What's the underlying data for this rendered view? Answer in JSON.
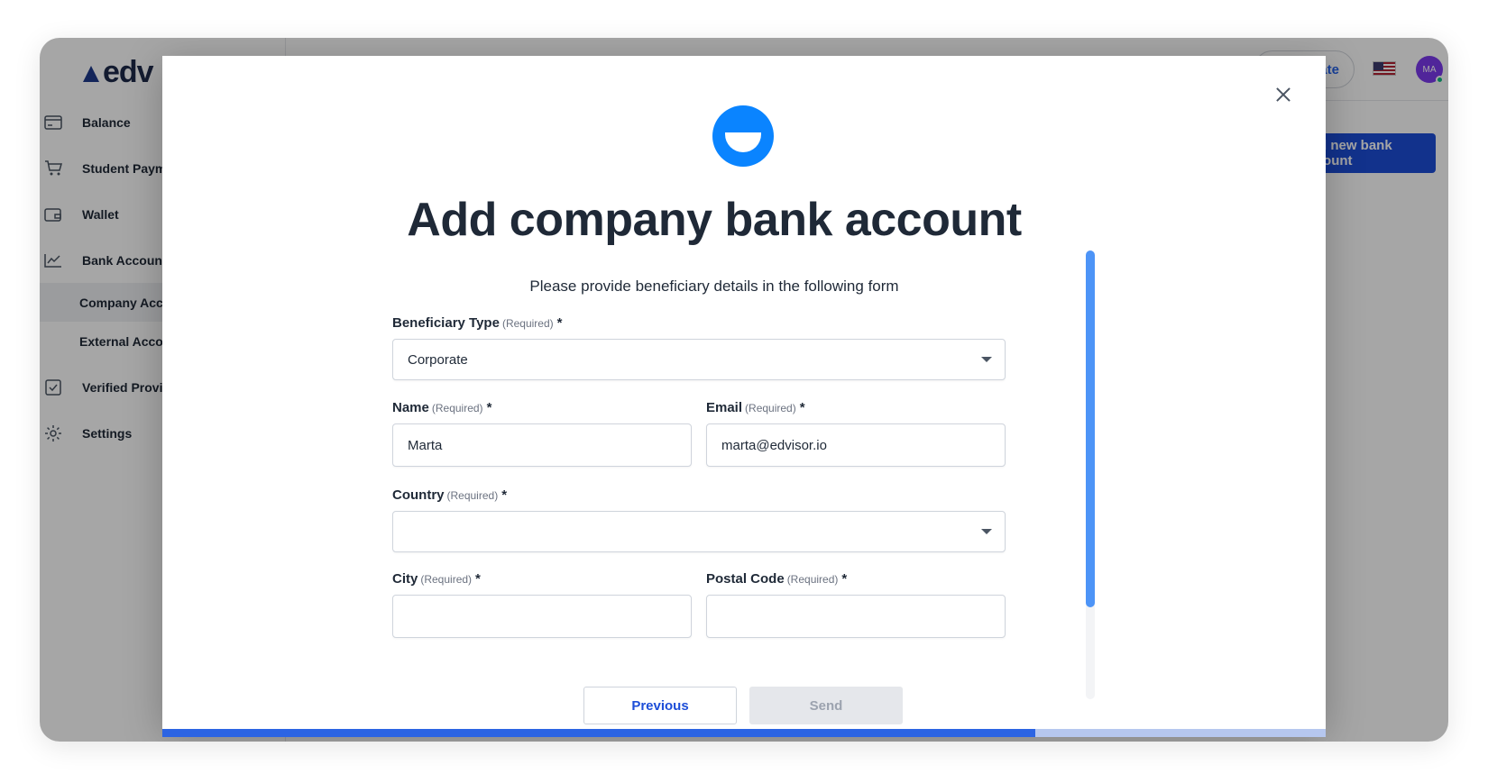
{
  "app": {
    "logo_text": "edv",
    "sidebar": {
      "items": [
        {
          "label": "Balance",
          "icon": "card-icon"
        },
        {
          "label": "Student Payments",
          "icon": "cart-icon"
        },
        {
          "label": "Wallet",
          "icon": "wallet-icon"
        },
        {
          "label": "Bank Accounts",
          "icon": "chart-icon"
        }
      ],
      "sub_items": [
        {
          "label": "Company Accounts",
          "active": true
        },
        {
          "label": "External Accounts",
          "active": false
        }
      ],
      "bottom_items": [
        {
          "label": "Verified Providers",
          "icon": "checkbox-icon"
        },
        {
          "label": "Settings",
          "icon": "gear-icon"
        }
      ]
    },
    "topbar": {
      "pill_label": "Create",
      "avatar_initials": "MA"
    },
    "main": {
      "add_button_label": "Add new bank account"
    }
  },
  "modal": {
    "title": "Add company bank account",
    "subtitle": "Please provide beneficiary details in the following form",
    "fields": {
      "beneficiary_type": {
        "label": "Beneficiary Type",
        "required_text": "(Required)",
        "value": "Corporate"
      },
      "name": {
        "label": "Name",
        "required_text": "(Required)",
        "value": "Marta"
      },
      "email": {
        "label": "Email",
        "required_text": "(Required)",
        "value": "marta@edvisor.io"
      },
      "country": {
        "label": "Country",
        "required_text": "(Required)",
        "value": ""
      },
      "city": {
        "label": "City",
        "required_text": "(Required)",
        "value": ""
      },
      "postal_code": {
        "label": "Postal Code",
        "required_text": "(Required)",
        "value": ""
      }
    },
    "star": "*",
    "buttons": {
      "previous": "Previous",
      "send": "Send"
    },
    "progress": 0.75,
    "colors": {
      "primary": "#1d4ed8",
      "progress": "#2c64e3",
      "brand_icon": "#0a84ff"
    }
  }
}
